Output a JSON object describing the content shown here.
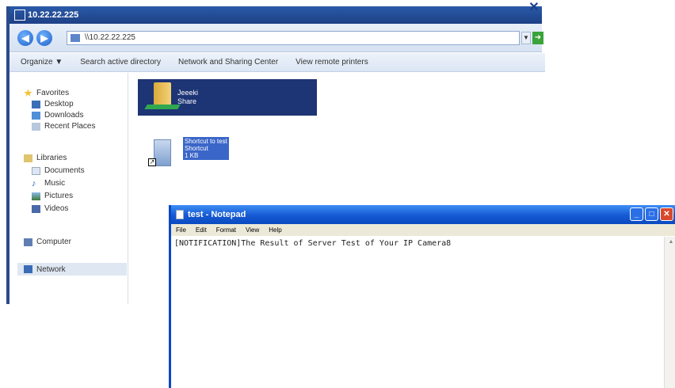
{
  "explorer": {
    "title": "10.22.22.225",
    "address": "\\\\10.22.22.225",
    "toolbar": [
      "Organize ▼",
      "Search active directory",
      "Network and Sharing Center",
      "View remote printers"
    ],
    "nav": {
      "favorites": "Favorites",
      "favorite_items": [
        "Desktop",
        "Downloads",
        "Recent Places"
      ],
      "libraries": "Libraries",
      "library_items": [
        "Documents",
        "Music",
        "Pictures",
        "Videos"
      ],
      "computer": "Computer",
      "network": "Network"
    },
    "folder": {
      "name": "Jeeeki",
      "type": "Share"
    },
    "shortcut": {
      "name": "Shortcut to test",
      "type": "Shortcut",
      "size": "1 KB"
    }
  },
  "notepad": {
    "title": "test - Notepad",
    "menu": [
      "File",
      "Edit",
      "Format",
      "View",
      "Help"
    ],
    "content": "[NOTIFICATION]The Result of Server Test of Your IP Camera8"
  },
  "colors": {
    "explorer_title": "#1d4086",
    "notepad_title": "#1559d3",
    "selected_tile": "#1d3475"
  }
}
